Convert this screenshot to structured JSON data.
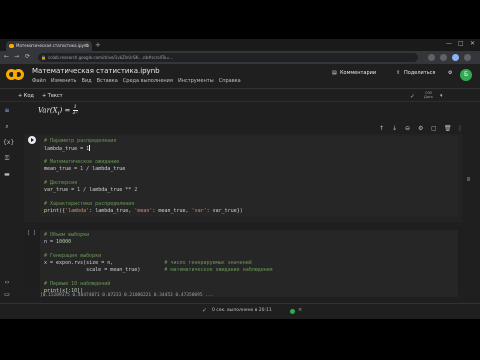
{
  "browser": {
    "tab_title": "Математическая статистика.ipynb",
    "url": "colab.research.google.com/drive/1vkZlnUrSK-...nb#scrollTo=...",
    "new_tab_label": "+",
    "tab_close_label": "×",
    "controls": {
      "minimize": "—",
      "maximize": "□",
      "close": "✕"
    },
    "nav": {
      "back": "←",
      "forward": "→",
      "reload": "⟳"
    }
  },
  "header": {
    "title": "Математическая статистика.ipynb",
    "star": "☆",
    "menu": [
      "Файл",
      "Изменить",
      "Вид",
      "Вставка",
      "Среда выполнения",
      "Инструменты",
      "Справка"
    ],
    "comments_label": "Комментарии",
    "share_label": "Поделиться",
    "settings_icon": "⚙",
    "avatar_letter": "Б"
  },
  "toolbar": {
    "add_code_label": "+ Код",
    "add_text_label": "+ Текст",
    "ram_label": "ОЗУ",
    "disk_label": "Диск",
    "check": "✓",
    "dropdown": "▾"
  },
  "formula": {
    "var_label": "Var(X",
    "sub": "i",
    "eq": ") = ",
    "num": "1",
    "den": "λ²"
  },
  "cells": [
    {
      "bracket": "",
      "lines": [
        [
          {
            "t": "# Параметр распределения",
            "c": "c"
          }
        ],
        [
          {
            "t": "lambda_true = ",
            "c": ""
          },
          {
            "t": "1",
            "c": "n"
          },
          {
            "t": "cursor",
            "c": "cursor"
          }
        ],
        [],
        [
          {
            "t": "# Математическое ожидание",
            "c": "c"
          }
        ],
        [
          {
            "t": "mean_true = ",
            "c": ""
          },
          {
            "t": "1",
            "c": "n"
          },
          {
            "t": " / lambda_true",
            "c": ""
          }
        ],
        [],
        [
          {
            "t": "# Дисперсия",
            "c": "c"
          }
        ],
        [
          {
            "t": "var_true = ",
            "c": ""
          },
          {
            "t": "1",
            "c": "n"
          },
          {
            "t": " / lambda_true ** ",
            "c": ""
          },
          {
            "t": "2",
            "c": "n"
          }
        ],
        [],
        [
          {
            "t": "# Характеристики распределения",
            "c": "c"
          }
        ],
        [
          {
            "t": "print",
            "c": "f"
          },
          {
            "t": "({",
            "c": ""
          },
          {
            "t": "'lambda'",
            "c": "s"
          },
          {
            "t": ": lambda_true, ",
            "c": ""
          },
          {
            "t": "'mean'",
            "c": "s"
          },
          {
            "t": ": mean_true, ",
            "c": ""
          },
          {
            "t": "'var'",
            "c": "s"
          },
          {
            "t": ": var_true})",
            "c": ""
          }
        ]
      ]
    },
    {
      "bracket": "[ ]",
      "lines": [
        [
          {
            "t": "# Объем выборки",
            "c": "c"
          }
        ],
        [
          {
            "t": "n = ",
            "c": ""
          },
          {
            "t": "10000",
            "c": "n"
          }
        ],
        [],
        [
          {
            "t": "# Генерация выборки",
            "c": "c"
          }
        ],
        [
          {
            "t": "x = expon.rvs(size = n,                 ",
            "c": ""
          },
          {
            "t": "# число генерируемых значений",
            "c": "c"
          }
        ],
        [
          {
            "t": "              scale = mean_true)        ",
            "c": ""
          },
          {
            "t": "# математическое ожидание наблюдения",
            "c": "c"
          }
        ],
        [],
        [
          {
            "t": "# Первые 10 наблюдений",
            "c": "c"
          }
        ],
        [
          {
            "t": "print",
            "c": "f"
          },
          {
            "t": "(x[:",
            "c": ""
          },
          {
            "t": "10",
            "c": "n"
          },
          {
            "t": "])",
            "c": ""
          }
        ]
      ]
    }
  ],
  "output_text": "[0.15209375 0.40474071 0.07233 0.21086221 0.34453 0.47358095 ...",
  "status": {
    "check": "✓",
    "text": "0 сек.   выполнено в 20:11",
    "close": "×"
  }
}
